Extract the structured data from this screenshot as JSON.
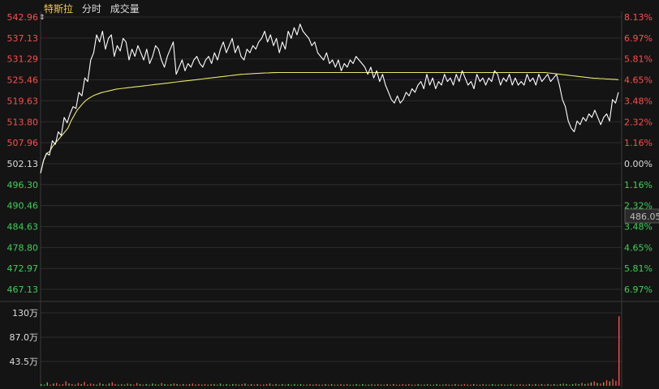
{
  "header": {
    "stock_name": "特斯拉",
    "tab_intraday": "分时",
    "tab_volume": "成交量"
  },
  "price_axis": {
    "labels": [
      "542.96",
      "537.13",
      "531.29",
      "525.46",
      "519.63",
      "513.80",
      "507.96",
      "502.13",
      "496.30",
      "490.46",
      "484.63",
      "478.80",
      "472.97",
      "467.13"
    ],
    "pct_labels": [
      "8.13%",
      "6.97%",
      "5.81%",
      "4.65%",
      "3.48%",
      "2.32%",
      "1.16%",
      "0.00%",
      "1.16%",
      "2.32%",
      "3.48%",
      "4.65%",
      "5.81%",
      "6.97%"
    ],
    "current_price_tag": "486.05"
  },
  "volume_axis": {
    "labels": [
      "130万",
      "87.0万",
      "43.5万"
    ]
  },
  "colors": {
    "up": "#ff4d4d",
    "down": "#3ed058",
    "neutral": "#dcdcdc",
    "price_line": "#ffffff",
    "avg_line": "#e8e66a",
    "grid": "#2c2c2c"
  },
  "chart_data": {
    "type": "line",
    "title": "特斯拉 分时",
    "ylim": [
      467.13,
      542.96
    ],
    "reference_price": 502.13,
    "series": [
      {
        "values": [
          499.5,
          503,
          505,
          504.5,
          508.5,
          507.5,
          511,
          510,
          515,
          513.5,
          516,
          518,
          517.5,
          522,
          521,
          526,
          525,
          531,
          533,
          538,
          536,
          539,
          534,
          537,
          538,
          532,
          535,
          533.5,
          537,
          536,
          531,
          534,
          532,
          535,
          533,
          531,
          534,
          530,
          532,
          535,
          534,
          531,
          529,
          532,
          534,
          536,
          527,
          529,
          531,
          528,
          530,
          529,
          531,
          532,
          530,
          529,
          531,
          532,
          530,
          533,
          531,
          534,
          536,
          533,
          535,
          537,
          533,
          535,
          532,
          531,
          534,
          533,
          535,
          534,
          536,
          537,
          539,
          536,
          538,
          535,
          537,
          533,
          536,
          534,
          539,
          537,
          540,
          538,
          541,
          539,
          538,
          537,
          535,
          536,
          533,
          532,
          531,
          533,
          530,
          531,
          529,
          531,
          528,
          530,
          529,
          531,
          530,
          532,
          531,
          530,
          529,
          527,
          529,
          526,
          528,
          525,
          527,
          524,
          522,
          520,
          519,
          521,
          519,
          520,
          522,
          521,
          523,
          522,
          524,
          525,
          523,
          527,
          524,
          526,
          523,
          525,
          524,
          527,
          525,
          526,
          524,
          527,
          525,
          528,
          526,
          524,
          525,
          523,
          527,
          525,
          526,
          524,
          526,
          525,
          528,
          527,
          524,
          526,
          525,
          527,
          524,
          526,
          524,
          525,
          524,
          527,
          525,
          526,
          524,
          527,
          525,
          526,
          527,
          525,
          526,
          527,
          524,
          520,
          518,
          514,
          512,
          511,
          514,
          513,
          515,
          514,
          516,
          515,
          517,
          515,
          513,
          515,
          516,
          514,
          520,
          519,
          522
        ]
      },
      {
        "values": [
          499.5,
          503,
          505,
          505.5,
          507,
          508,
          509,
          510,
          511,
          512,
          514,
          515.5,
          517,
          518,
          519,
          519.8,
          520.4,
          520.9,
          521.3,
          521.6,
          521.9,
          522.1,
          522.3,
          522.5,
          522.7,
          522.9,
          523,
          523.1,
          523.2,
          523.3,
          523.4,
          523.5,
          523.6,
          523.7,
          523.8,
          523.9,
          524,
          524.1,
          524.2,
          524.3,
          524.4,
          524.5,
          524.6,
          524.7,
          524.8,
          524.9,
          525,
          525.1,
          525.2,
          525.3,
          525.4,
          525.5,
          525.6,
          525.7,
          525.8,
          525.9,
          526,
          526.1,
          526.2,
          526.3,
          526.4,
          526.5,
          526.6,
          526.7,
          526.8,
          526.9,
          527,
          527.05,
          527.1,
          527.15,
          527.2,
          527.25,
          527.3,
          527.35,
          527.4,
          527.42,
          527.45,
          527.47,
          527.5,
          527.5,
          527.5,
          527.5,
          527.5,
          527.5,
          527.5,
          527.5,
          527.5,
          527.5,
          527.5,
          527.5,
          527.5,
          527.5,
          527.5,
          527.5,
          527.5,
          527.5,
          527.5,
          527.5,
          527.5,
          527.5,
          527.5,
          527.5,
          527.5,
          527.5,
          527.5,
          527.5,
          527.5,
          527.5,
          527.5,
          527.5,
          527.5,
          527.5,
          527.5,
          527.5,
          527.5,
          527.5,
          527.5,
          527.5,
          527.5,
          527.5,
          527.5,
          527.5,
          527.5,
          527.5,
          527.5,
          527.5,
          527.5,
          527.5,
          527.5,
          527.5,
          527.5,
          527.5,
          527.5,
          527.5,
          527.5,
          527.5,
          527.5,
          527.5,
          527.5,
          527.5,
          527.5,
          527.5,
          527.5,
          527.5,
          527.5,
          527.5,
          527.5,
          527.5,
          527.5,
          527.5,
          527.5,
          527.5,
          527.5,
          527.5,
          527.5,
          527.5,
          527.5,
          527.5,
          527.5,
          527.5,
          527.5,
          527.5,
          527.5,
          527.5,
          527.5,
          527.5,
          527.5,
          527.4,
          527.3,
          527.2,
          527.1,
          527,
          526.9,
          526.8,
          526.7,
          526.6,
          526.5,
          526.4,
          526.3,
          526.2,
          526.1,
          526,
          525.9,
          525.9,
          525.8,
          525.8,
          525.7,
          525.7,
          525.6,
          525.6,
          525.5
        ]
      }
    ],
    "volume": {
      "ylim": [
        0,
        130
      ],
      "values": [
        3,
        2,
        6,
        2,
        4,
        5,
        2,
        3,
        8,
        4,
        3,
        2,
        5,
        3,
        7,
        2,
        4,
        3,
        2,
        5,
        3,
        2,
        4,
        6,
        3,
        2,
        3,
        2,
        4,
        3,
        2,
        5,
        3,
        2,
        3,
        2,
        4,
        3,
        2,
        5,
        3,
        2,
        3,
        4,
        3,
        2,
        3,
        2,
        3,
        4,
        2,
        3,
        2,
        3,
        2,
        3,
        3,
        2,
        4,
        2,
        3,
        2,
        3,
        3,
        2,
        3,
        4,
        2,
        3,
        2,
        3,
        2,
        2,
        3,
        4,
        2,
        3,
        2,
        3,
        2,
        3,
        2,
        3,
        2,
        3,
        2,
        2,
        3,
        2,
        3,
        2,
        2,
        3,
        2,
        3,
        2,
        2,
        3,
        2,
        3,
        2,
        2,
        3,
        2,
        3,
        2,
        2,
        3,
        2,
        3,
        2,
        2,
        3,
        2,
        3,
        2,
        2,
        3,
        2,
        3,
        2,
        2,
        3,
        2,
        2,
        3,
        2,
        2,
        3,
        2,
        2,
        3,
        2,
        2,
        3,
        2,
        2,
        3,
        2,
        2,
        3,
        2,
        2,
        3,
        2,
        2,
        3,
        2,
        2,
        3,
        2,
        2,
        3,
        2,
        2,
        3,
        2,
        2,
        3,
        2,
        3,
        2,
        3,
        2,
        3,
        2,
        3,
        2,
        3,
        4,
        3,
        2,
        3,
        4,
        3,
        5,
        3,
        4,
        6,
        8,
        5,
        4,
        6,
        10,
        8,
        12,
        9,
        124
      ],
      "colors": [
        "down",
        "down",
        "down",
        "up",
        "down",
        "up",
        "down",
        "up",
        "up",
        "down",
        "up",
        "down",
        "up",
        "down",
        "up",
        "down",
        "up",
        "up",
        "down",
        "up",
        "down",
        "up",
        "down",
        "up",
        "up",
        "down",
        "up",
        "down",
        "up",
        "down",
        "up",
        "up",
        "down",
        "up",
        "down",
        "up",
        "down",
        "up",
        "down",
        "up",
        "down",
        "up",
        "down",
        "up",
        "down",
        "up",
        "down",
        "up",
        "down",
        "up",
        "down",
        "up",
        "down",
        "up",
        "down",
        "up",
        "down",
        "up",
        "down",
        "up",
        "down",
        "up",
        "down",
        "up",
        "down",
        "up",
        "down",
        "up",
        "down",
        "up",
        "down",
        "up",
        "down",
        "up",
        "down",
        "up",
        "down",
        "up",
        "down",
        "up",
        "down",
        "up",
        "down",
        "up",
        "down",
        "up",
        "down",
        "up",
        "down",
        "up",
        "down",
        "up",
        "down",
        "up",
        "down",
        "up",
        "down",
        "up",
        "down",
        "up",
        "down",
        "up",
        "down",
        "up",
        "down",
        "up",
        "down",
        "up",
        "down",
        "up",
        "down",
        "up",
        "down",
        "up",
        "down",
        "up",
        "down",
        "up",
        "down",
        "up",
        "down",
        "up",
        "down",
        "up",
        "down",
        "up",
        "down",
        "up",
        "down",
        "up",
        "down",
        "up",
        "down",
        "up",
        "down",
        "up",
        "down",
        "up",
        "down",
        "up",
        "down",
        "up",
        "down",
        "up",
        "down",
        "up",
        "down",
        "up",
        "down",
        "up",
        "down",
        "up",
        "down",
        "up",
        "down",
        "up",
        "down",
        "up",
        "down",
        "up",
        "down",
        "up",
        "down",
        "up",
        "down",
        "up",
        "down",
        "up",
        "down",
        "up",
        "down",
        "up",
        "down",
        "up",
        "down",
        "up",
        "down",
        "up",
        "down",
        "up",
        "down",
        "up",
        "down",
        "up",
        "down",
        "up",
        "up",
        "up"
      ]
    }
  }
}
